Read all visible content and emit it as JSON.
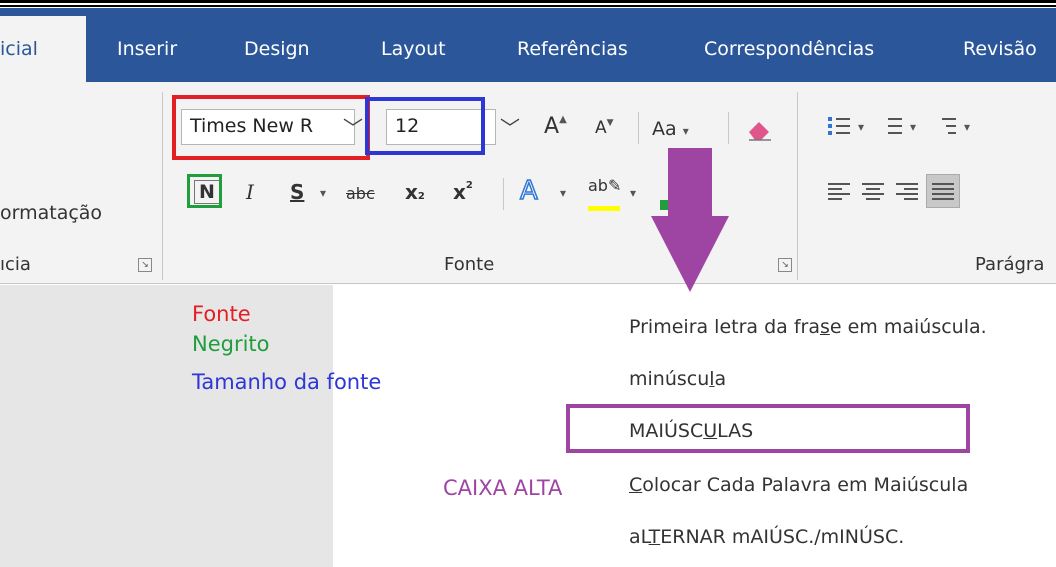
{
  "tabs": [
    {
      "label": "icial",
      "active": true
    },
    {
      "label": "Inserir"
    },
    {
      "label": "Design"
    },
    {
      "label": "Layout"
    },
    {
      "label": "Referências"
    },
    {
      "label": "Correspondências"
    },
    {
      "label": "Revisão"
    }
  ],
  "ribbon": {
    "clipboard_partial_label": "ormatação",
    "clipboard_group_label": "ıcia",
    "font_name": "Times New R",
    "font_size": "12",
    "grow_font": "A",
    "shrink_font": "A",
    "change_case": "Aa",
    "bold": "N",
    "italic": "I",
    "underline": "S",
    "strike": "abc",
    "subscript": "x",
    "subscript_mark": "2",
    "superscript": "x",
    "superscript_mark": "2",
    "text_effects": "A",
    "highlight": "ab",
    "font_group_label": "Fonte",
    "paragraph_group_label": "Parágra"
  },
  "legend": {
    "font": "Fonte",
    "bold": "Negrito",
    "size": "Tamanho da fonte",
    "caps": "CAIXA ALTA"
  },
  "case_menu": [
    {
      "before": "Primeira letra da fra",
      "key": "s",
      "after": "e em maiúscula."
    },
    {
      "before": "minúscu",
      "key": "l",
      "after": "a"
    },
    {
      "before": "MAIÚSC",
      "key": "U",
      "after": "LAS"
    },
    {
      "before": "",
      "key": "C",
      "after": "olocar Cada Palavra em Maiúscula"
    },
    {
      "before": "aL",
      "key": "T",
      "after": "ERNAR mAIÚSC./mINÚSC."
    }
  ],
  "colors": {
    "tab_blue": "#2b579a",
    "red": "#e31e24",
    "blue": "#2e36d6",
    "green": "#1f9e3b",
    "purple": "#9e45a3"
  }
}
